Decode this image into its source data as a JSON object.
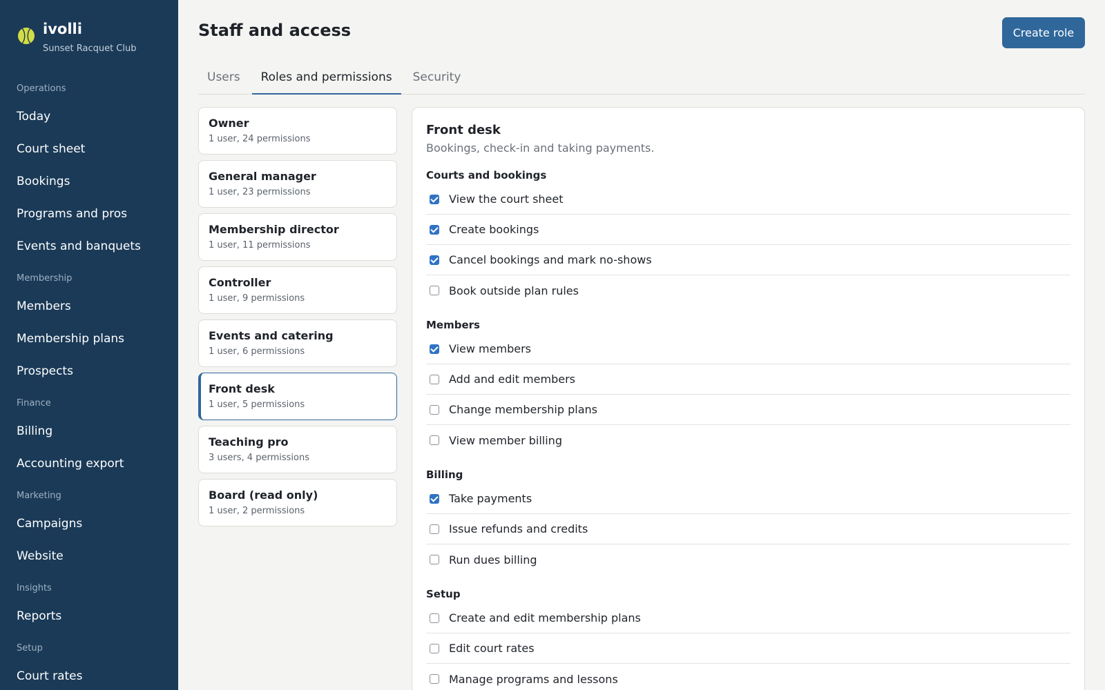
{
  "brand": {
    "name": "ivolli",
    "club": "Sunset Racquet Club"
  },
  "sidebar": {
    "groups": [
      {
        "label": "Operations",
        "items": [
          "Today",
          "Court sheet",
          "Bookings",
          "Programs and pros",
          "Events and banquets"
        ]
      },
      {
        "label": "Membership",
        "items": [
          "Members",
          "Membership plans",
          "Prospects"
        ]
      },
      {
        "label": "Finance",
        "items": [
          "Billing",
          "Accounting export"
        ]
      },
      {
        "label": "Marketing",
        "items": [
          "Campaigns",
          "Website"
        ]
      },
      {
        "label": "Insights",
        "items": [
          "Reports"
        ]
      },
      {
        "label": "Setup",
        "items": [
          "Court rates"
        ]
      }
    ]
  },
  "header": {
    "title": "Staff and access",
    "create_label": "Create role"
  },
  "tabs": [
    {
      "label": "Users",
      "active": false
    },
    {
      "label": "Roles and permissions",
      "active": true
    },
    {
      "label": "Security",
      "active": false
    }
  ],
  "roles": [
    {
      "name": "Owner",
      "meta": "1 user, 24 permissions",
      "active": false
    },
    {
      "name": "General manager",
      "meta": "1 user, 23 permissions",
      "active": false
    },
    {
      "name": "Membership director",
      "meta": "1 user, 11 permissions",
      "active": false
    },
    {
      "name": "Controller",
      "meta": "1 user, 9 permissions",
      "active": false
    },
    {
      "name": "Events and catering",
      "meta": "1 user, 6 permissions",
      "active": false
    },
    {
      "name": "Front desk",
      "meta": "1 user, 5 permissions",
      "active": true
    },
    {
      "name": "Teaching pro",
      "meta": "3 users, 4 permissions",
      "active": false
    },
    {
      "name": "Board (read only)",
      "meta": "1 user, 2 permissions",
      "active": false
    }
  ],
  "detail": {
    "title": "Front desk",
    "description": "Bookings, check-in and taking payments.",
    "groups": [
      {
        "title": "Courts and bookings",
        "permissions": [
          {
            "label": "View the court sheet",
            "checked": true
          },
          {
            "label": "Create bookings",
            "checked": true
          },
          {
            "label": "Cancel bookings and mark no-shows",
            "checked": true
          },
          {
            "label": "Book outside plan rules",
            "checked": false
          }
        ]
      },
      {
        "title": "Members",
        "permissions": [
          {
            "label": "View members",
            "checked": true
          },
          {
            "label": "Add and edit members",
            "checked": false
          },
          {
            "label": "Change membership plans",
            "checked": false
          },
          {
            "label": "View member billing",
            "checked": false
          }
        ]
      },
      {
        "title": "Billing",
        "permissions": [
          {
            "label": "Take payments",
            "checked": true
          },
          {
            "label": "Issue refunds and credits",
            "checked": false
          },
          {
            "label": "Run dues billing",
            "checked": false
          }
        ]
      },
      {
        "title": "Setup",
        "permissions": [
          {
            "label": "Create and edit membership plans",
            "checked": false
          },
          {
            "label": "Edit court rates",
            "checked": false
          },
          {
            "label": "Manage programs and lessons",
            "checked": false
          }
        ]
      }
    ]
  },
  "icons": {
    "logo": "tennis-ball-icon"
  },
  "colors": {
    "sidebar": "#1a3a57",
    "accent": "#2f679b",
    "checkbox": "#2f73c4",
    "ball": "#d3dc46"
  }
}
